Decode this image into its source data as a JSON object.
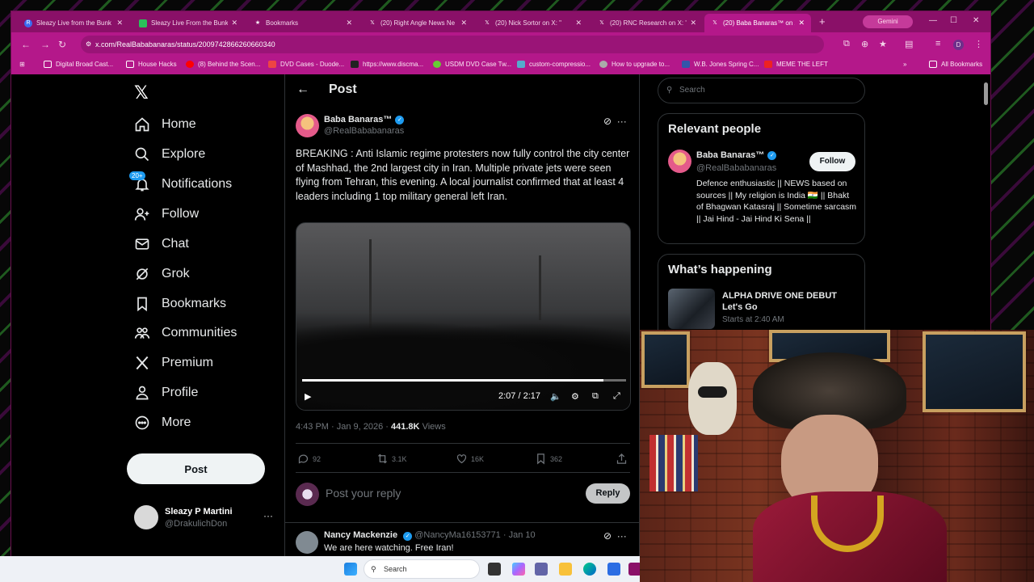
{
  "browser": {
    "tabs": [
      {
        "title": "Sleazy Live from the Bunk",
        "active": false
      },
      {
        "title": "Sleazy Live From the Bunk",
        "active": false
      },
      {
        "title": "Bookmarks",
        "active": false
      },
      {
        "title": "(20) Right Angle News Ne",
        "active": false
      },
      {
        "title": "(20) Nick Sortor on X: \"",
        "active": false
      },
      {
        "title": "(20) RNC Research on X: \"",
        "active": false
      },
      {
        "title": "(20) Baba Banaras™ on X:",
        "active": true
      }
    ],
    "gemini_label": "Gemini",
    "url": "x.com/RealBababanaras/status/2009742866260660340",
    "bookmarks": [
      "Digital Broad Cast...",
      "House Hacks",
      "(8) Behind the Scen...",
      "DVD Cases - Duode...",
      "https://www.discma...",
      "USDM DVD Case Tw...",
      "custom-compressio...",
      "How to upgrade to...",
      "W.B. Jones Spring C...",
      "MEME THE LEFT"
    ],
    "all_bookmarks": "All Bookmarks",
    "profile_initial": "D"
  },
  "sidebar": {
    "logo": "𝕏",
    "items": [
      {
        "label": "Home",
        "icon": "home-icon"
      },
      {
        "label": "Explore",
        "icon": "search-icon"
      },
      {
        "label": "Notifications",
        "icon": "bell-icon",
        "badge": "20+"
      },
      {
        "label": "Follow",
        "icon": "follow-icon"
      },
      {
        "label": "Chat",
        "icon": "mail-icon"
      },
      {
        "label": "Grok",
        "icon": "grok-icon"
      },
      {
        "label": "Bookmarks",
        "icon": "bookmark-icon"
      },
      {
        "label": "Communities",
        "icon": "communities-icon"
      },
      {
        "label": "Premium",
        "icon": "x-icon"
      },
      {
        "label": "Profile",
        "icon": "person-icon"
      },
      {
        "label": "More",
        "icon": "more-icon"
      }
    ],
    "post_label": "Post",
    "account": {
      "name": "Sleazy P Martini",
      "handle": "@DrakulichDon",
      "menu": "···"
    }
  },
  "post": {
    "header": "Post",
    "author": {
      "name": "Baba Banaras™",
      "handle": "@RealBababanaras"
    },
    "text": "BREAKING : Anti Islamic regime protesters now fully control the city center of Mashhad, the 2nd largest city in Iran. Multiple private jets were seen flying from Tehran, this evening. A local journalist confirmed that at least 4 leaders including 1 top military general left Iran.",
    "video": {
      "time": "2:07 / 2:17",
      "progress": 0.93
    },
    "timestamp": "4:43 PM · Jan 9, 2026 · ",
    "views_count": "441.8K",
    "views_label": "Views",
    "stats": {
      "replies": "92",
      "reposts": "3.1K",
      "likes": "16K",
      "bookmarks": "362"
    },
    "reply_placeholder": "Post your reply",
    "reply_button": "Reply"
  },
  "comment": {
    "name": "Nancy Mackenzie",
    "handle": "@NancyMa16153771 · Jan 10",
    "text": "We are here watching. Free Iran!"
  },
  "right": {
    "search_placeholder": "Search",
    "relevant_title": "Relevant people",
    "person": {
      "name": "Baba Banaras™",
      "handle": "@RealBababanaras",
      "follow": "Follow",
      "bio": "Defence enthusiastic || NEWS based on sources || My religion is India 🇮🇳 || Bhakt of Bhagwan Katasraj || Sometime sarcasm || Jai Hind - Jai Hind Ki Sena ||"
    },
    "happening_title": "What’s happening",
    "trend": {
      "title": "ALPHA DRIVE ONE DEBUT Let's Go",
      "sub": "Starts at 2:40 AM"
    }
  },
  "taskbar": {
    "search": "Search"
  }
}
